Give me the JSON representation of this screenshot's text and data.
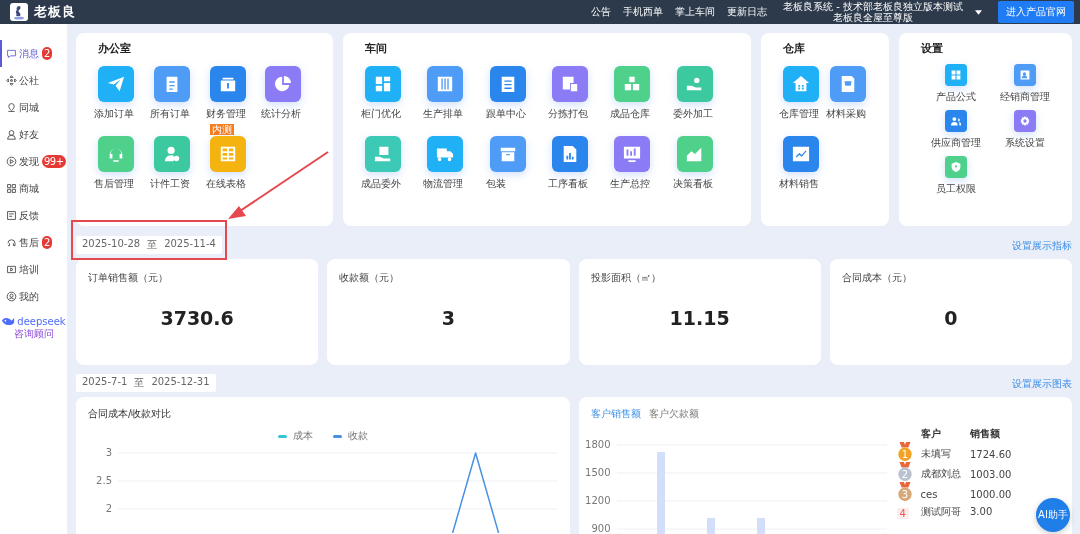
{
  "topbar": {
    "brand": "老板良",
    "nav": [
      "公告",
      "手机西单",
      "掌上车间",
      "更新日志"
    ],
    "account_lines": [
      "老板良系统 - 技术部老板良独立版本测试",
      "老板良全屋至尊版"
    ],
    "cta": "进入产品官网"
  },
  "sidebar": {
    "items": [
      {
        "label": "消息",
        "selected": true,
        "badge": "2"
      },
      {
        "label": "公社",
        "selected": false
      },
      {
        "label": "同城",
        "selected": false
      },
      {
        "label": "好友",
        "selected": false
      },
      {
        "label": "发现",
        "selected": false,
        "badge": "99+"
      },
      {
        "label": "商城",
        "selected": false
      },
      {
        "label": "反馈",
        "selected": false
      },
      {
        "label": "售后",
        "selected": false,
        "badge": "2"
      },
      {
        "label": "培训",
        "selected": false
      },
      {
        "label": "我的",
        "selected": false
      }
    ],
    "deepseek": {
      "name": "deepseek",
      "caption": "咨询顾问"
    }
  },
  "sections": [
    {
      "title": "办公室",
      "kind": "large",
      "tiles": [
        {
          "label": "添加订单",
          "color": "#1fb0f5"
        },
        {
          "label": "所有订单",
          "color": "#4f9cf7"
        },
        {
          "label": "财务管理",
          "color": "#2a86ec"
        },
        {
          "label": "统计分析",
          "color": "#8b7cf6"
        },
        {
          "label": "售后管理",
          "color": "#4fd18b"
        },
        {
          "label": "计件工资",
          "color": "#3cc9a0"
        },
        {
          "label": "在线表格",
          "color": "#f5b30f",
          "badge": "内测"
        }
      ]
    },
    {
      "title": "车间",
      "kind": "large",
      "tiles": [
        {
          "label": "柜门优化",
          "color": "#1fb0f5"
        },
        {
          "label": "生产排单",
          "color": "#4f9cf7"
        },
        {
          "label": "跟单中心",
          "color": "#2a86ec"
        },
        {
          "label": "分拣打包",
          "color": "#8b7cf6"
        },
        {
          "label": "成品仓库",
          "color": "#4fd18b"
        },
        {
          "label": "委外加工",
          "color": "#3cc9a0"
        },
        {
          "label": "成品委外",
          "color": "#3cc9b5"
        },
        {
          "label": "物流管理",
          "color": "#1fb0f5"
        },
        {
          "label": "包装",
          "color": "#4f9cf7"
        },
        {
          "label": "工序看板",
          "color": "#2a86ec"
        },
        {
          "label": "生产总控",
          "color": "#8b7cf6"
        },
        {
          "label": "决策看板",
          "color": "#4fd18b"
        }
      ]
    },
    {
      "title": "仓库",
      "kind": "large",
      "tiles": [
        {
          "label": "仓库管理",
          "color": "#1fb0f5"
        },
        {
          "label": "材料采购",
          "color": "#4f9cf7"
        },
        {
          "label": "材料销售",
          "color": "#2a86ec"
        }
      ]
    },
    {
      "title": "设置",
      "kind": "small",
      "tiles": [
        {
          "label": "产品公式",
          "color": "#1fb0f5"
        },
        {
          "label": "经销商管理",
          "color": "#4f9cf7"
        },
        {
          "label": "供应商管理",
          "color": "#2a86ec"
        },
        {
          "label": "系统设置",
          "color": "#8b7cf6"
        },
        {
          "label": "员工权限",
          "color": "#4fd18b"
        }
      ]
    }
  ],
  "kpi_range": {
    "start": "2025-10-28",
    "separator": "至",
    "end": "2025-11-4"
  },
  "kpi_link": "设置展示指标",
  "kpis": [
    {
      "label": "订单销售额（元）",
      "value": "3730.6"
    },
    {
      "label": "收款额（元）",
      "value": "3"
    },
    {
      "label": "投影面积（㎡）",
      "value": "11.15"
    },
    {
      "label": "合同成本（元）",
      "value": "0"
    }
  ],
  "chart_range": {
    "start": "2025-7-1",
    "separator": "至",
    "end": "2025-12-31"
  },
  "chart_link": "设置展示图表",
  "compare_card": {
    "title": "合同成本/收款对比",
    "legend": [
      {
        "name": "成本",
        "color": "#36c6d3"
      },
      {
        "name": "收款",
        "color": "#4a90e2"
      }
    ],
    "y_ticks": [
      "3",
      "2.5",
      "2"
    ]
  },
  "customer_card": {
    "tabs": [
      {
        "label": "客户销售额",
        "selected": true
      },
      {
        "label": "客户欠款额",
        "selected": false
      }
    ],
    "y_ticks": [
      "1800",
      "1500",
      "1200",
      "900"
    ],
    "table": {
      "columns": [
        "客户",
        "销售额"
      ],
      "rows": [
        {
          "rank": "1",
          "kind": "medal",
          "color": "#f2a325",
          "customer": "未填写",
          "amount": "1724.60"
        },
        {
          "rank": "2",
          "kind": "medal",
          "color": "#b9c3cf",
          "customer": "成都刘总",
          "amount": "1003.00"
        },
        {
          "rank": "3",
          "kind": "medal",
          "color": "#d9a878",
          "customer": "ces",
          "amount": "1000.00"
        },
        {
          "rank": "4",
          "kind": "number",
          "customer": "测试阿哥",
          "amount": "3.00"
        }
      ]
    }
  },
  "assistant_button": "AI助手"
}
